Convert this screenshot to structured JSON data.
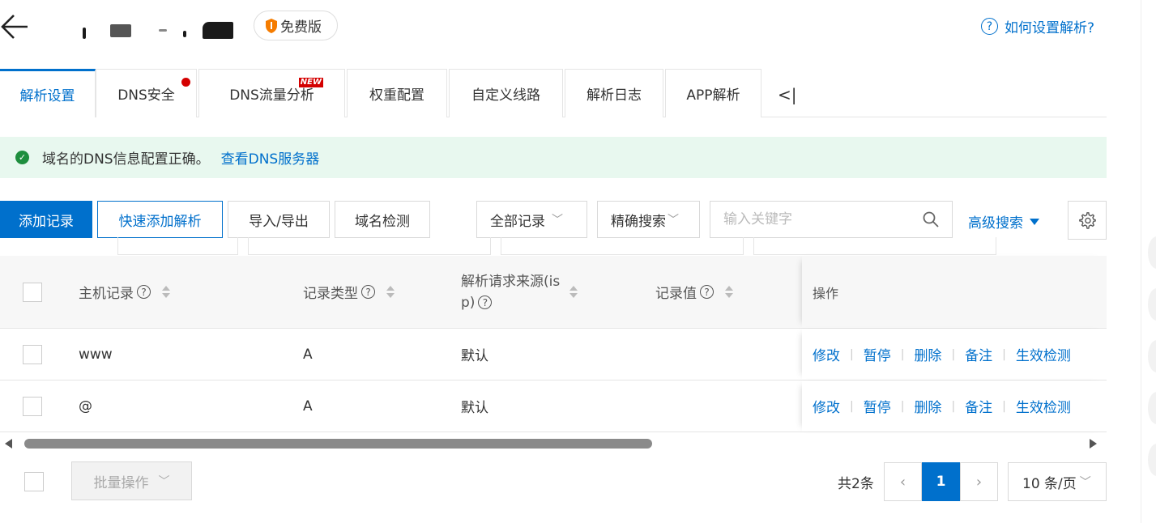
{
  "header": {
    "back_icon": "arrow-left-icon",
    "edition_badge": "免费版",
    "help_link": "如何设置解析?"
  },
  "tabs": [
    {
      "label": "解析设置",
      "active": true
    },
    {
      "label": "DNS安全",
      "has_dot": true
    },
    {
      "label": "DNS流量分析",
      "badge": "NEW"
    },
    {
      "label": "权重配置"
    },
    {
      "label": "自定义线路"
    },
    {
      "label": "解析日志"
    },
    {
      "label": "APP解析"
    }
  ],
  "tab_collapse": "<|",
  "notice": {
    "text": "域名的DNS信息配置正确。",
    "link": "查看DNS服务器",
    "status_color": "#1e8e3e"
  },
  "toolbar": {
    "add_record": "添加记录",
    "quick_add": "快速添加解析",
    "import_export": "导入/导出",
    "domain_check": "域名检测",
    "record_filter": "全部记录",
    "search_mode": "精确搜索",
    "search_placeholder": "输入关键字",
    "advanced_search": "高级搜索"
  },
  "table": {
    "columns": [
      "主机记录",
      "记录类型",
      "解析请求来源(isp)",
      "记录值",
      "操作"
    ],
    "isp_line1": "解析请求来源(is",
    "isp_line2": "p)",
    "rows": [
      {
        "host": "www",
        "type": "A",
        "isp": "默认",
        "value": ""
      },
      {
        "host": "@",
        "type": "A",
        "isp": "默认",
        "value": ""
      }
    ],
    "actions": [
      "修改",
      "暂停",
      "删除",
      "备注",
      "生效检测"
    ]
  },
  "footer": {
    "batch": "批量操作",
    "total": "共2条",
    "current_page": "1",
    "per_page": "10 条/页"
  },
  "colors": {
    "accent": "#0070cc",
    "alert": "#d40000",
    "success_bg": "#e8f8ef"
  }
}
